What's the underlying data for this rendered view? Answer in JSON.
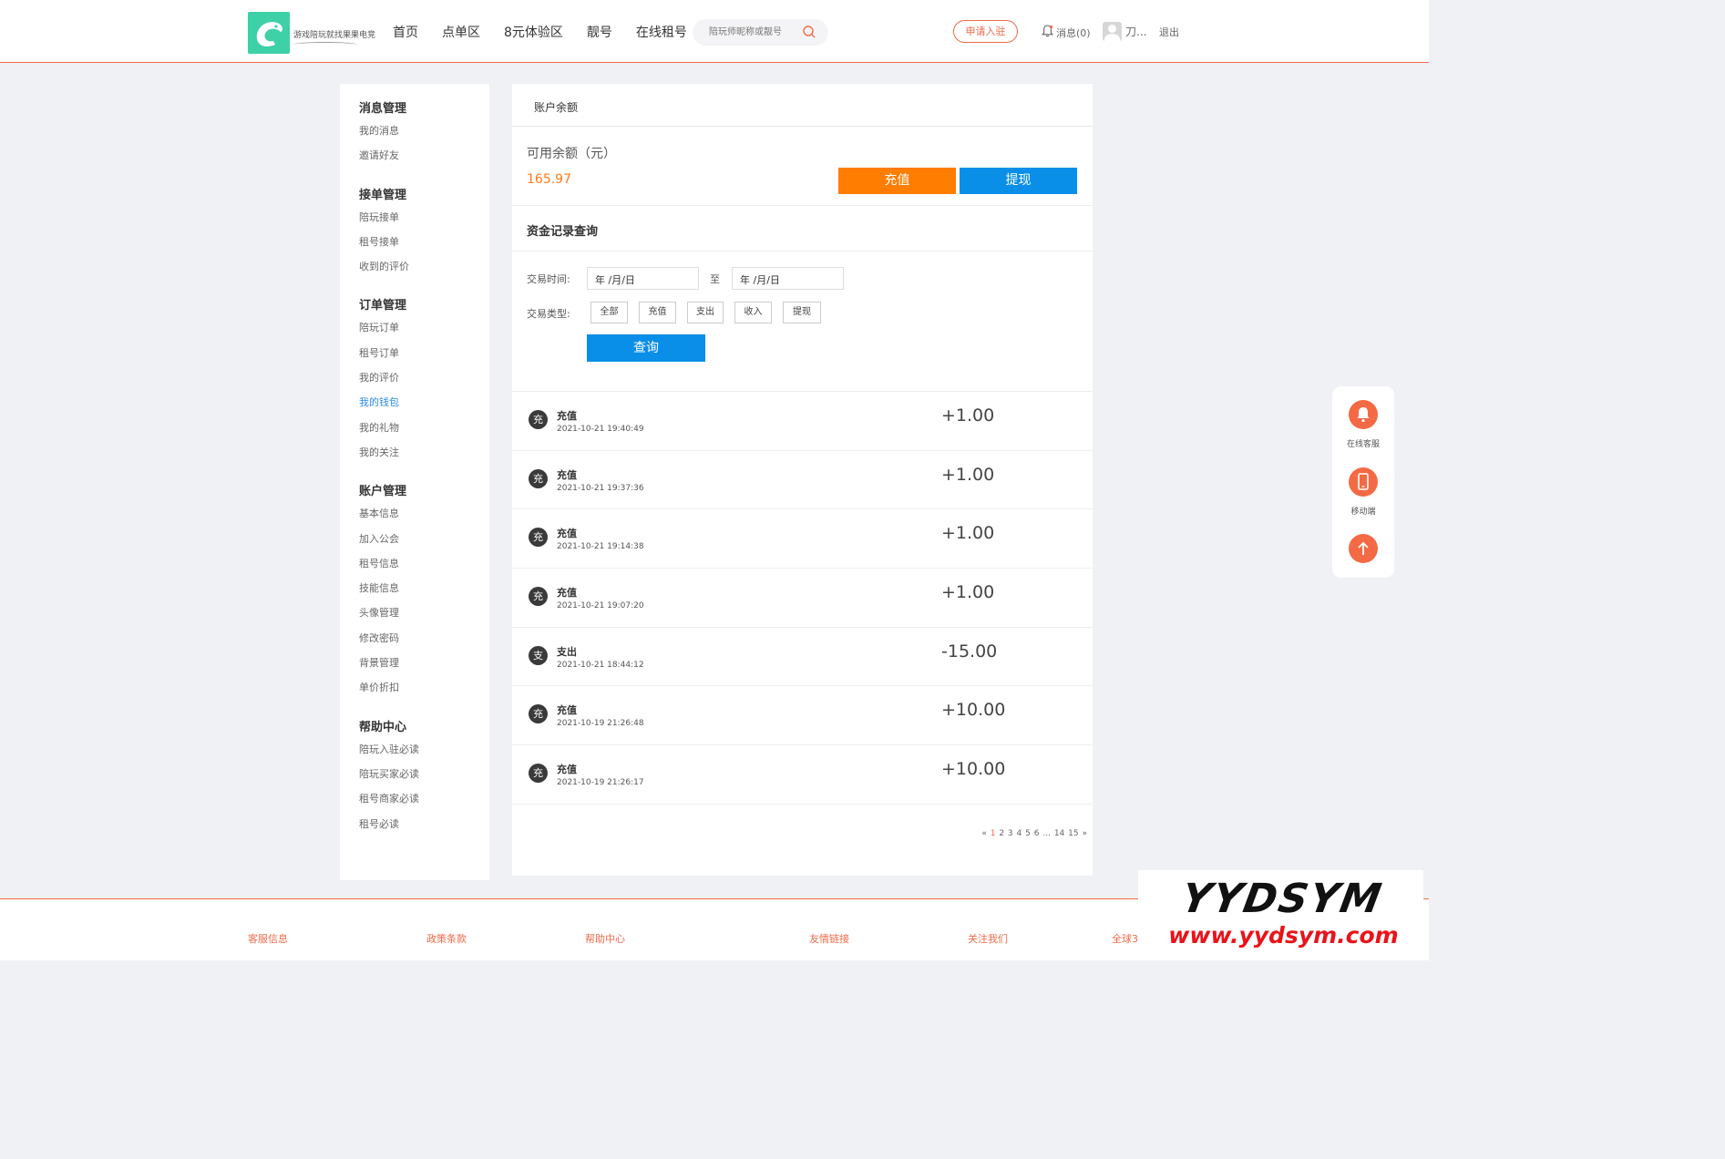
{
  "header": {
    "logo_text": "游戏陪玩就找果果电竞",
    "nav": [
      "首页",
      "点单区",
      "8元体验区",
      "靓号",
      "在线租号"
    ],
    "search_placeholder": "陪玩师昵称或靓号",
    "apply_label": "申请入驻",
    "messages_label": "消息(0)",
    "username": "刀...",
    "logout_label": "退出"
  },
  "sidebar": {
    "groups": [
      {
        "title": "消息管理",
        "items": [
          "我的消息",
          "邀请好友"
        ]
      },
      {
        "title": "接单管理",
        "items": [
          "陪玩接单",
          "租号接单",
          "收到的评价"
        ]
      },
      {
        "title": "订单管理",
        "items": [
          "陪玩订单",
          "租号订单",
          "我的评价",
          "我的钱包",
          "我的礼物",
          "我的关注"
        ]
      },
      {
        "title": "账户管理",
        "items": [
          "基本信息",
          "加入公会",
          "租号信息",
          "技能信息",
          "头像管理",
          "修改密码",
          "背景管理",
          "单价折扣"
        ]
      },
      {
        "title": "帮助中心",
        "items": [
          "陪玩入驻必读",
          "陪玩买家必读",
          "租号商家必读",
          "租号必读"
        ]
      }
    ],
    "active_item": "我的钱包"
  },
  "main": {
    "section_title": "账户余额",
    "balance_label": "可用余额（元）",
    "balance_value": "165.97",
    "recharge_label": "充值",
    "withdraw_label": "提现",
    "query_title": "资金记录查询",
    "trade_time_label": "交易时间:",
    "date_from": "年 /月/日",
    "to_label": "至",
    "date_to": "年 /月/日",
    "trade_type_label": "交易类型:",
    "types": [
      "全部",
      "充值",
      "支出",
      "收入",
      "提现"
    ],
    "query_button": "查询"
  },
  "records": [
    {
      "icon": "充",
      "type": "充值",
      "time": "2021-10-21 19:40:49",
      "amount": "+1.00"
    },
    {
      "icon": "充",
      "type": "充值",
      "time": "2021-10-21 19:37:36",
      "amount": "+1.00"
    },
    {
      "icon": "充",
      "type": "充值",
      "time": "2021-10-21 19:14:38",
      "amount": "+1.00"
    },
    {
      "icon": "充",
      "type": "充值",
      "time": "2021-10-21 19:07:20",
      "amount": "+1.00"
    },
    {
      "icon": "支",
      "type": "支出",
      "time": "2021-10-21 18:44:12",
      "amount": "-15.00"
    },
    {
      "icon": "充",
      "type": "充值",
      "time": "2021-10-19 21:26:48",
      "amount": "+10.00"
    },
    {
      "icon": "充",
      "type": "充值",
      "time": "2021-10-19 21:26:17",
      "amount": "+10.00"
    }
  ],
  "pagination": {
    "prev": "«",
    "pages": [
      "1",
      "2",
      "3",
      "4",
      "5",
      "6",
      "...",
      "14",
      "15"
    ],
    "current": "1",
    "next": "»"
  },
  "float_bar": {
    "service_label": "在线客服",
    "mobile_label": "移动端"
  },
  "footer": {
    "columns": [
      "客服信息",
      "政策条款",
      "帮助中心",
      "友情链接",
      "关注我们",
      "全球3"
    ]
  },
  "watermark": {
    "line1": "YYDSYM",
    "line2": "www.yydsym.com"
  },
  "colors": {
    "accent_orange": "#ff7d00",
    "accent_blue": "#0a8fe8",
    "brand_red": "#f06a4a",
    "logo_green": "#3ed1a8"
  }
}
